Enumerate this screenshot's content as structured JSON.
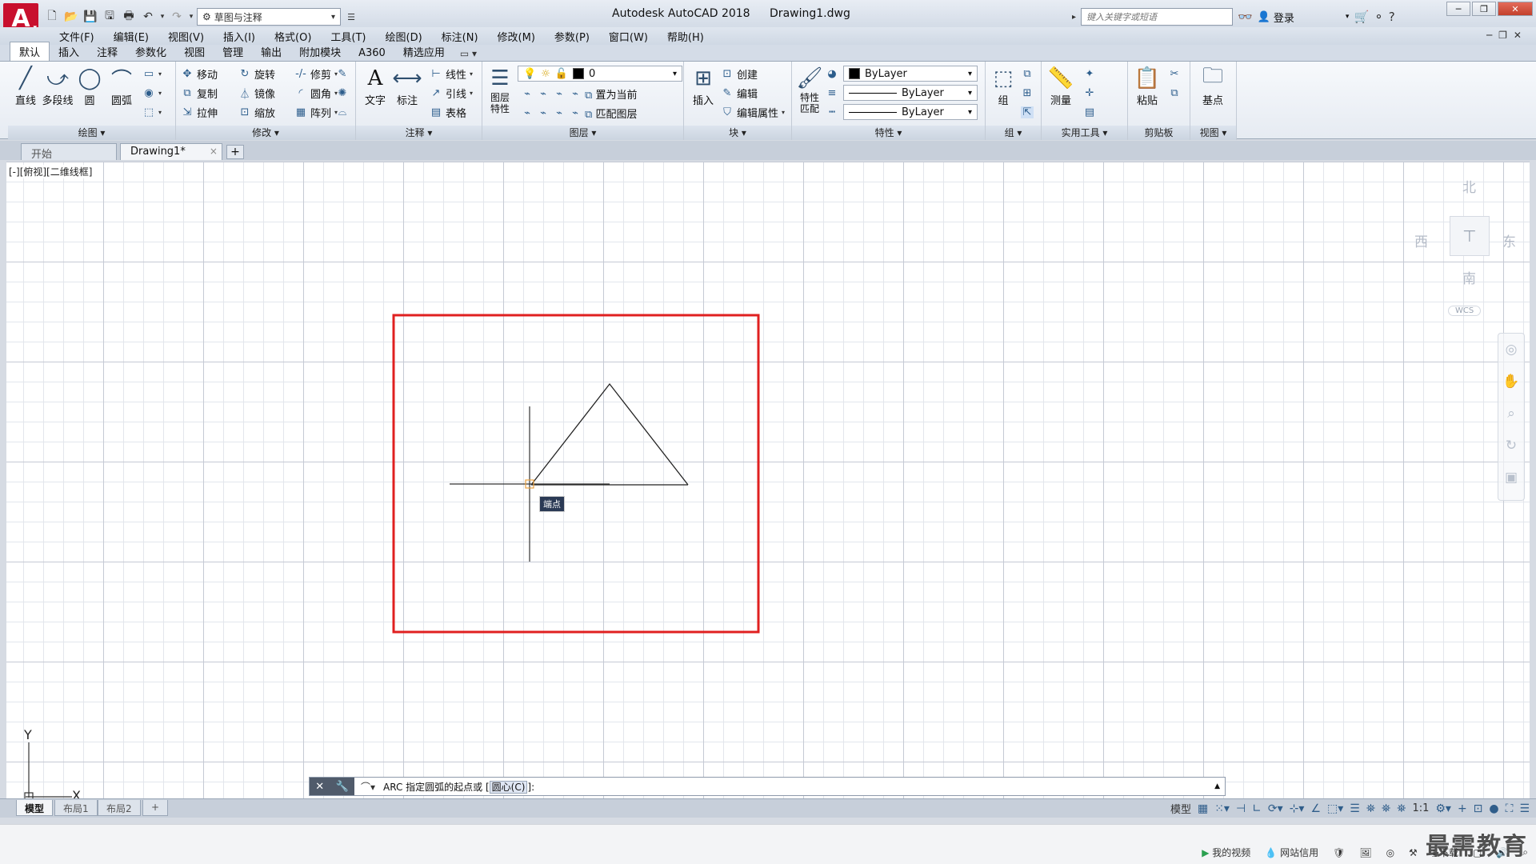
{
  "app": {
    "logo_letter": "A",
    "title": "Autodesk AutoCAD 2018",
    "document": "Drawing1.dwg",
    "workspace": "草图与注释",
    "search_placeholder": "键入关键字或短语",
    "login": "登录"
  },
  "menu": [
    "文件(F)",
    "编辑(E)",
    "视图(V)",
    "插入(I)",
    "格式(O)",
    "工具(T)",
    "绘图(D)",
    "标注(N)",
    "修改(M)",
    "参数(P)",
    "窗口(W)",
    "帮助(H)"
  ],
  "ribbon_tabs": [
    "默认",
    "插入",
    "注释",
    "参数化",
    "视图",
    "管理",
    "输出",
    "附加模块",
    "A360",
    "精选应用"
  ],
  "ribbon_tab_extra": "▭ ▾",
  "ribbon": {
    "draw": {
      "title": "绘图",
      "line": "直线",
      "polyline": "多段线",
      "circle": "圆",
      "arc": "圆弧"
    },
    "modify": {
      "title": "修改",
      "move": "移动",
      "rotate": "旋转",
      "trim": "修剪",
      "copy": "复制",
      "mirror": "镜像",
      "fillet": "圆角",
      "stretch": "拉伸",
      "scale": "缩放",
      "array": "阵列"
    },
    "annotation": {
      "title": "注释",
      "text": "文字",
      "dimension": "标注",
      "linear": "线性",
      "leader": "引线",
      "table": "表格"
    },
    "layers": {
      "title": "图层",
      "layer_props": "图层\n特性",
      "current_layer": "0",
      "set_current": "置为当前",
      "match_layer": "匹配图层"
    },
    "block": {
      "title": "块",
      "insert": "插入",
      "create": "创建",
      "edit": "编辑",
      "edit_attr": "编辑属性"
    },
    "properties": {
      "title": "特性",
      "match": "特性\n匹配",
      "color": "ByLayer",
      "linetype": "ByLayer",
      "lineweight": "ByLayer"
    },
    "groups": {
      "title": "组",
      "group": "组"
    },
    "utilities": {
      "title": "实用工具",
      "measure": "测量"
    },
    "clipboard": {
      "title": "剪贴板",
      "paste": "粘贴"
    },
    "view": {
      "title": "视图",
      "base": "基点"
    }
  },
  "file_tabs": {
    "start": "开始",
    "drawing": "Drawing1*",
    "close": "×",
    "add": "+"
  },
  "canvas": {
    "view_label": "[-][俯视][二维线框]",
    "tooltip": "端点",
    "viewcube": {
      "north": "北",
      "south": "南",
      "east": "东",
      "west": "西",
      "wcs": "WCS"
    },
    "ucs_x": "X",
    "ucs_y": "Y"
  },
  "command_line": {
    "prefix": "ARC 指定圆弧的起点或 [",
    "option": "圆心(C)",
    "suffix": "]:"
  },
  "layout_tabs": [
    "模型",
    "布局1",
    "布局2"
  ],
  "status": {
    "model": "模型",
    "scale": "1:1"
  },
  "taskbar": {
    "my_video": "我的视频",
    "network_credit": "网站信用",
    "download": "下载",
    "watermark": "最需教育"
  },
  "colors": {
    "accent_red": "#e02020",
    "logo_red": "#c8102e",
    "tooltip_bg": "#2b3a55"
  }
}
